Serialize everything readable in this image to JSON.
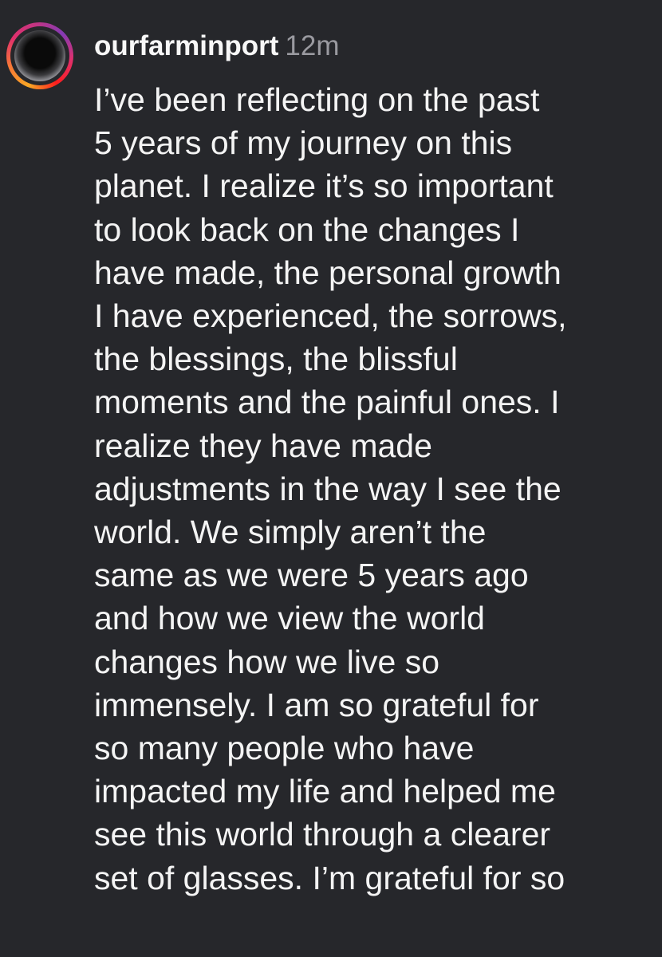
{
  "comment": {
    "username": "ourfarminport",
    "timestamp": "12m",
    "avatar_icon": "profile-avatar-story-ring",
    "story_ring_colors": [
      "#f9a825",
      "#f77737",
      "#e1306c",
      "#c13584",
      "#833ab4"
    ],
    "text_lines": [
      "I’ve been reflecting on the past",
      "5 years of my journey on this",
      "planet. I realize it’s so important",
      "to look back on the changes I",
      "have made, the personal growth",
      "I have experienced, the sorrows,",
      "the blessings, the blissful",
      "moments and the painful ones. I",
      "realize they have made",
      "adjustments in the way I see the",
      "world. We simply aren’t the",
      "same as we were 5 years ago",
      "and how we view the world",
      "changes how we live so",
      "immensely. I am so grateful for",
      "so many people who have",
      "impacted my life and helped me",
      "see this world through a clearer",
      "set of glasses. I’m grateful for so"
    ]
  },
  "colors": {
    "background": "#26272b",
    "text": "#f4f4f4",
    "timestamp": "#9a9aa0"
  }
}
